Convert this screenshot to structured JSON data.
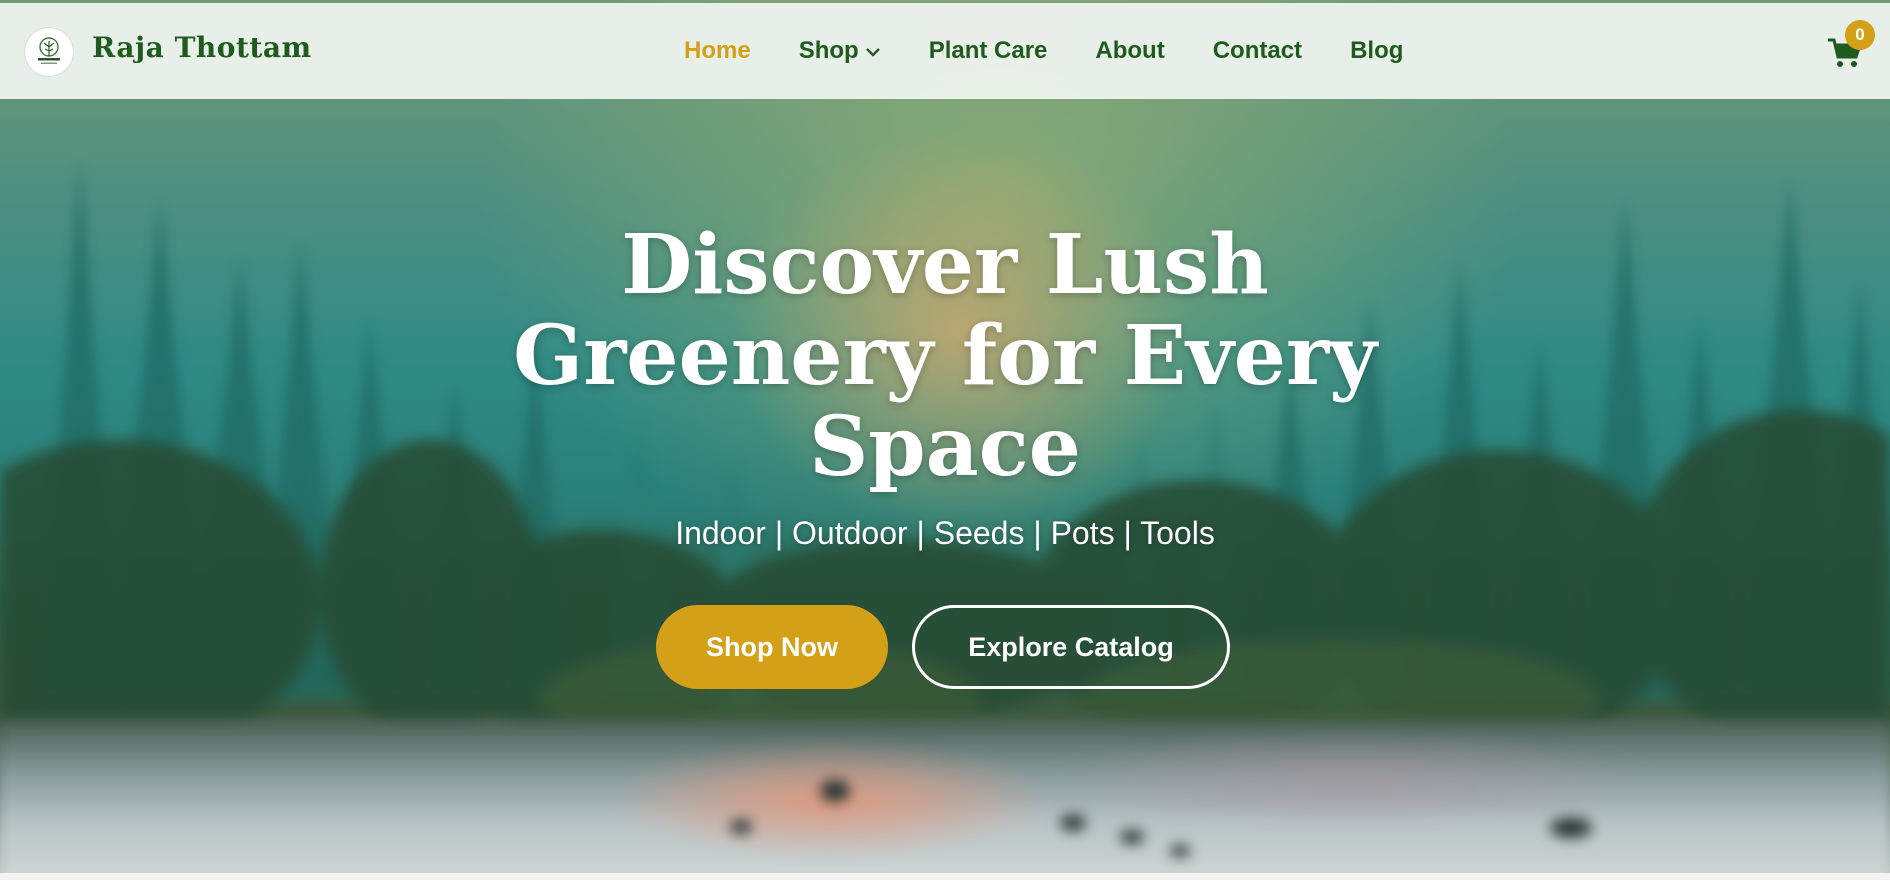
{
  "brand": {
    "name": "Raja Thottam",
    "logo_text": "RAJA THOTTAM"
  },
  "nav": {
    "items": [
      {
        "label": "Home",
        "active": true
      },
      {
        "label": "Shop",
        "has_dropdown": true
      },
      {
        "label": "Plant Care"
      },
      {
        "label": "About"
      },
      {
        "label": "Contact"
      },
      {
        "label": "Blog"
      }
    ]
  },
  "cart": {
    "icon": "cart-icon",
    "count": "0"
  },
  "hero": {
    "title_lines": [
      "Discover Lush",
      "Greenery for Every",
      "Space"
    ],
    "subtitle": "Indoor | Outdoor | Seeds | Pots | Tools",
    "primary_button": "Shop Now",
    "secondary_button": "Explore Catalog"
  },
  "colors": {
    "brand_green": "#1f5a1f",
    "accent_gold": "#d4a017",
    "navbar_bg": "#eef3ee"
  }
}
